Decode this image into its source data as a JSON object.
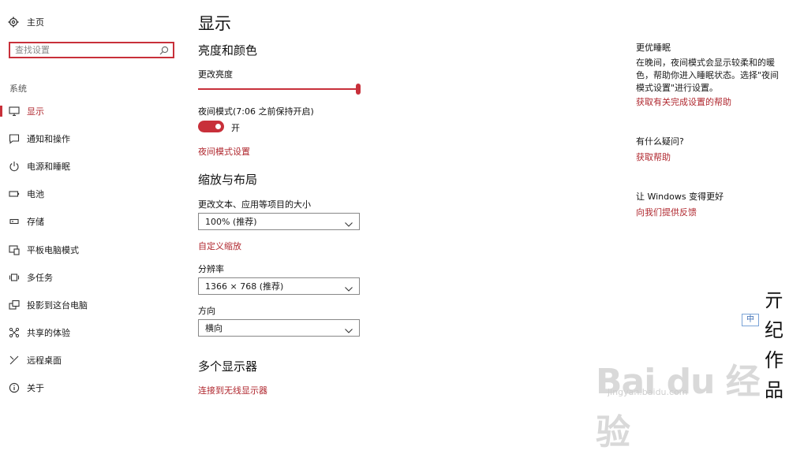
{
  "sidebar": {
    "home_label": "主页",
    "search_placeholder": "查找设置",
    "section_label": "系统",
    "items": [
      {
        "label": "显示",
        "icon": "monitor-icon",
        "active": true
      },
      {
        "label": "通知和操作",
        "icon": "message-icon"
      },
      {
        "label": "电源和睡眠",
        "icon": "power-icon"
      },
      {
        "label": "电池",
        "icon": "battery-icon"
      },
      {
        "label": "存储",
        "icon": "storage-icon"
      },
      {
        "label": "平板电脑模式",
        "icon": "tablet-icon"
      },
      {
        "label": "多任务",
        "icon": "multitask-icon"
      },
      {
        "label": "投影到这台电脑",
        "icon": "project-icon"
      },
      {
        "label": "共享的体验",
        "icon": "share-icon"
      },
      {
        "label": "远程桌面",
        "icon": "remote-icon"
      },
      {
        "label": "关于",
        "icon": "info-icon"
      }
    ]
  },
  "main": {
    "title": "显示",
    "brightness_section": "亮度和颜色",
    "brightness_label": "更改亮度",
    "brightness_level": 1.0,
    "night_mode_label": "夜间模式(7:06 之前保持开启)",
    "night_mode_state": "开",
    "night_mode_on": true,
    "night_mode_link": "夜间模式设置",
    "scale_section": "缩放与布局",
    "scale_label": "更改文本、应用等项目的大小",
    "scale_value": "100% (推荐)",
    "custom_scale_link": "自定义缩放",
    "resolution_label": "分辨率",
    "resolution_value": "1366 × 768 (推荐)",
    "orientation_label": "方向",
    "orientation_value": "横向",
    "multi_display_section": "多个显示器",
    "wireless_link": "连接到无线显示器"
  },
  "right": {
    "sleep_title": "更优睡眠",
    "sleep_desc": "在晚间，夜间模式会显示较柔和的暖色，帮助你进入睡眠状态。选择\"夜间模式设置\"进行设置。",
    "sleep_link": "获取有关完成设置的帮助",
    "question_title": "有什么疑问?",
    "question_link": "获取帮助",
    "improve_title": "让 Windows 变得更好",
    "improve_link": "向我们提供反馈"
  },
  "watermark": {
    "logo": "Bai du 经验",
    "url": "jingyan.baidu.com",
    "ime": "中",
    "signature": [
      "亓",
      "纪",
      "作",
      "品"
    ]
  },
  "colors": {
    "accent": "#c8303a",
    "link": "#b0282f"
  }
}
